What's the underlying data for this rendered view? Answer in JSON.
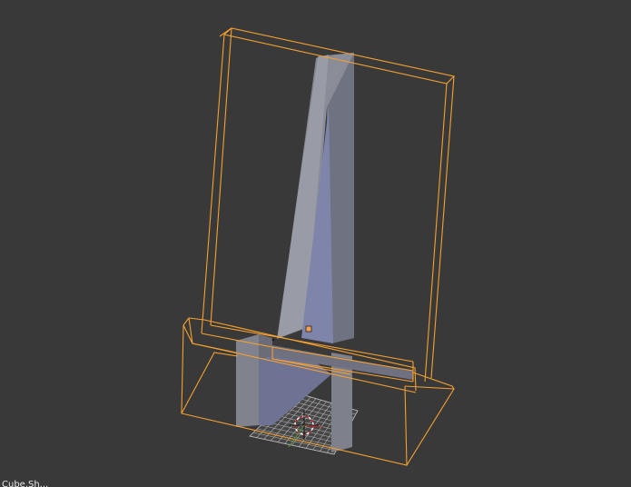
{
  "viewport": {
    "background_color": "#393939",
    "status_text": "Cube.Sh..."
  },
  "scene": {
    "selection_outline_color": "#f5a030",
    "object_face_color": "#80808a",
    "object_face_light_color": "#8c8e99",
    "object_face_shadow_color": "#5d5f66",
    "object_face_blue_color": "#7a7ea0",
    "grid_color": "#c8c8c8",
    "origin_color": "#f0a050",
    "cursor_red": "#cc2222",
    "cursor_white": "#ffffff"
  }
}
